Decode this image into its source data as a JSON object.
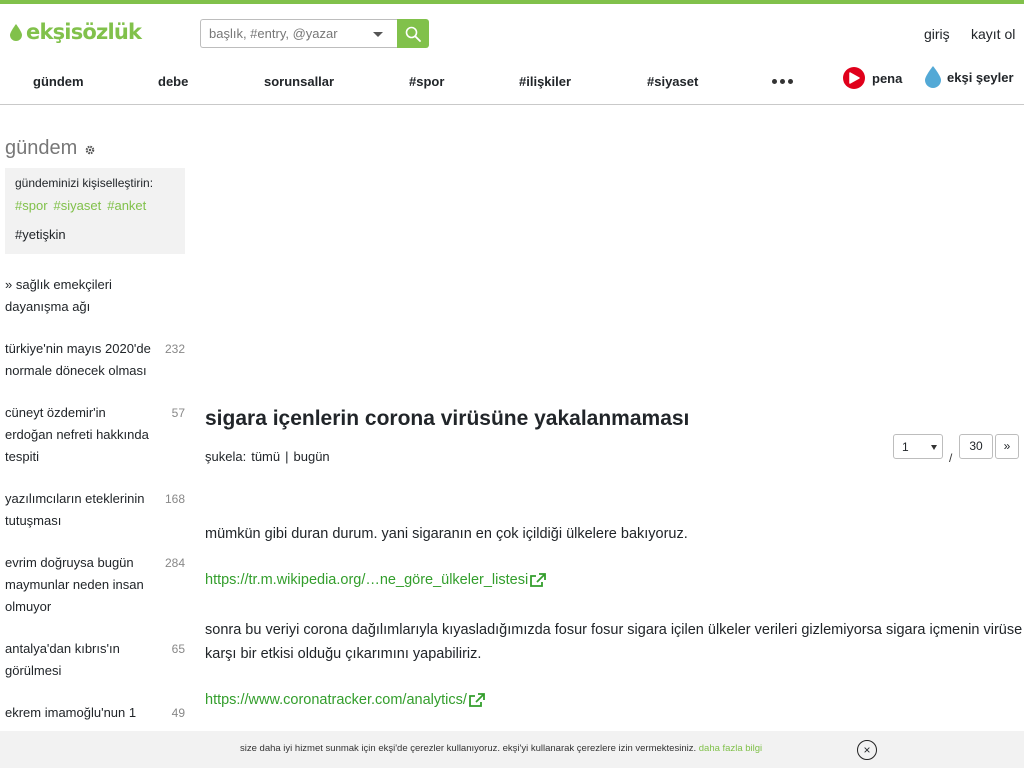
{
  "header": {
    "logo_text": "ekşisözlük",
    "search_placeholder": "başlık, #entry, @yazar",
    "login": "giriş",
    "register": "kayıt ol",
    "accent_color": "#81c14b"
  },
  "nav": {
    "items": [
      "gündem",
      "debe",
      "sorunsallar",
      "#spor",
      "#ilişkiler",
      "#siyaset"
    ],
    "more_icon": "more-dots-icon",
    "pena": "pena",
    "eksi_seyler": "ekşi şeyler"
  },
  "sidebar": {
    "title": "gündem",
    "personalize_title": "gündeminizi kişiselleştirin:",
    "tags": [
      "#spor",
      "#siyaset",
      "#anket"
    ],
    "adult_tag": "#yetişkin",
    "topics": [
      {
        "title": "» sağlık emekçileri dayanışma ağı",
        "count": ""
      },
      {
        "title": "türkiye'nin mayıs 2020'de normale dönecek olması",
        "count": "232"
      },
      {
        "title": "cüneyt özdemir'in erdoğan nefreti hakkında tespiti",
        "count": "57"
      },
      {
        "title": "yazılımcıların eteklerinin tutuşması",
        "count": "168"
      },
      {
        "title": "evrim doğruysa bugün maymunlar neden insan olmuyor",
        "count": "284"
      },
      {
        "title": "antalya'dan kıbrıs'ın görülmesi",
        "count": "65"
      },
      {
        "title": "ekrem imamoğlu'nun 1",
        "count": "49"
      }
    ]
  },
  "main": {
    "title": "sigara içenlerin corona virüsüne yakalanmaması",
    "filter_label": "şukela:",
    "filter_all": "tümü",
    "filter_sep": "|",
    "filter_today": "bugün",
    "pager": {
      "current": "1",
      "sep": "/",
      "total": "30",
      "next": "»"
    },
    "paragraph1": "mümkün gibi duran durum. yani sigaranın en çok içildiği ülkelere bakıyoruz.",
    "link1": "https://tr.m.wikipedia.org/…ne_göre_ülkeler_listesi",
    "paragraph2": "sonra bu veriyi corona dağılımlarıyla kıyasladığımızda fosur fosur sigara içilen ülkeler verileri gizlemiyorsa sigara içmenin virüse karşı bir etkisi olduğu çıkarımını yapabiliriz.",
    "link2": "https://www.coronatracker.com/analytics/"
  },
  "cookie": {
    "text": "size daha iyi hizmet sunmak için ekşi'de çerezler kullanıyoruz. ekşi'yi kullanarak çerezlere izin vermektesiniz.",
    "link": "daha fazla bilgi",
    "close": "×"
  }
}
